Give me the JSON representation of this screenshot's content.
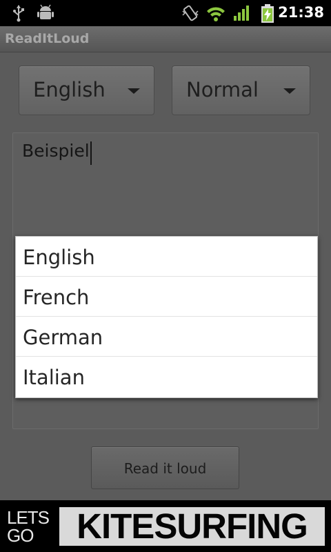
{
  "status_bar": {
    "time": "21:38",
    "icons": [
      "usb-icon",
      "android-debug-icon",
      "vibrate-icon",
      "wifi-icon",
      "signal-icon",
      "battery-charging-icon"
    ]
  },
  "app": {
    "title": "ReadItLoud"
  },
  "spinners": {
    "language": {
      "selected": "English"
    },
    "speed": {
      "selected": "Normal"
    }
  },
  "text_input": {
    "value": "Beispiel"
  },
  "dropdown": {
    "options": [
      "English",
      "French",
      "German",
      "Italian"
    ]
  },
  "read_button": {
    "label": "Read it loud"
  },
  "ad_banner": {
    "line1": "LETS",
    "line2": "GO",
    "brand": "KITESURFING"
  },
  "colors": {
    "battery_green": "#8cc63f",
    "wifi_green": "#8cc63f"
  }
}
